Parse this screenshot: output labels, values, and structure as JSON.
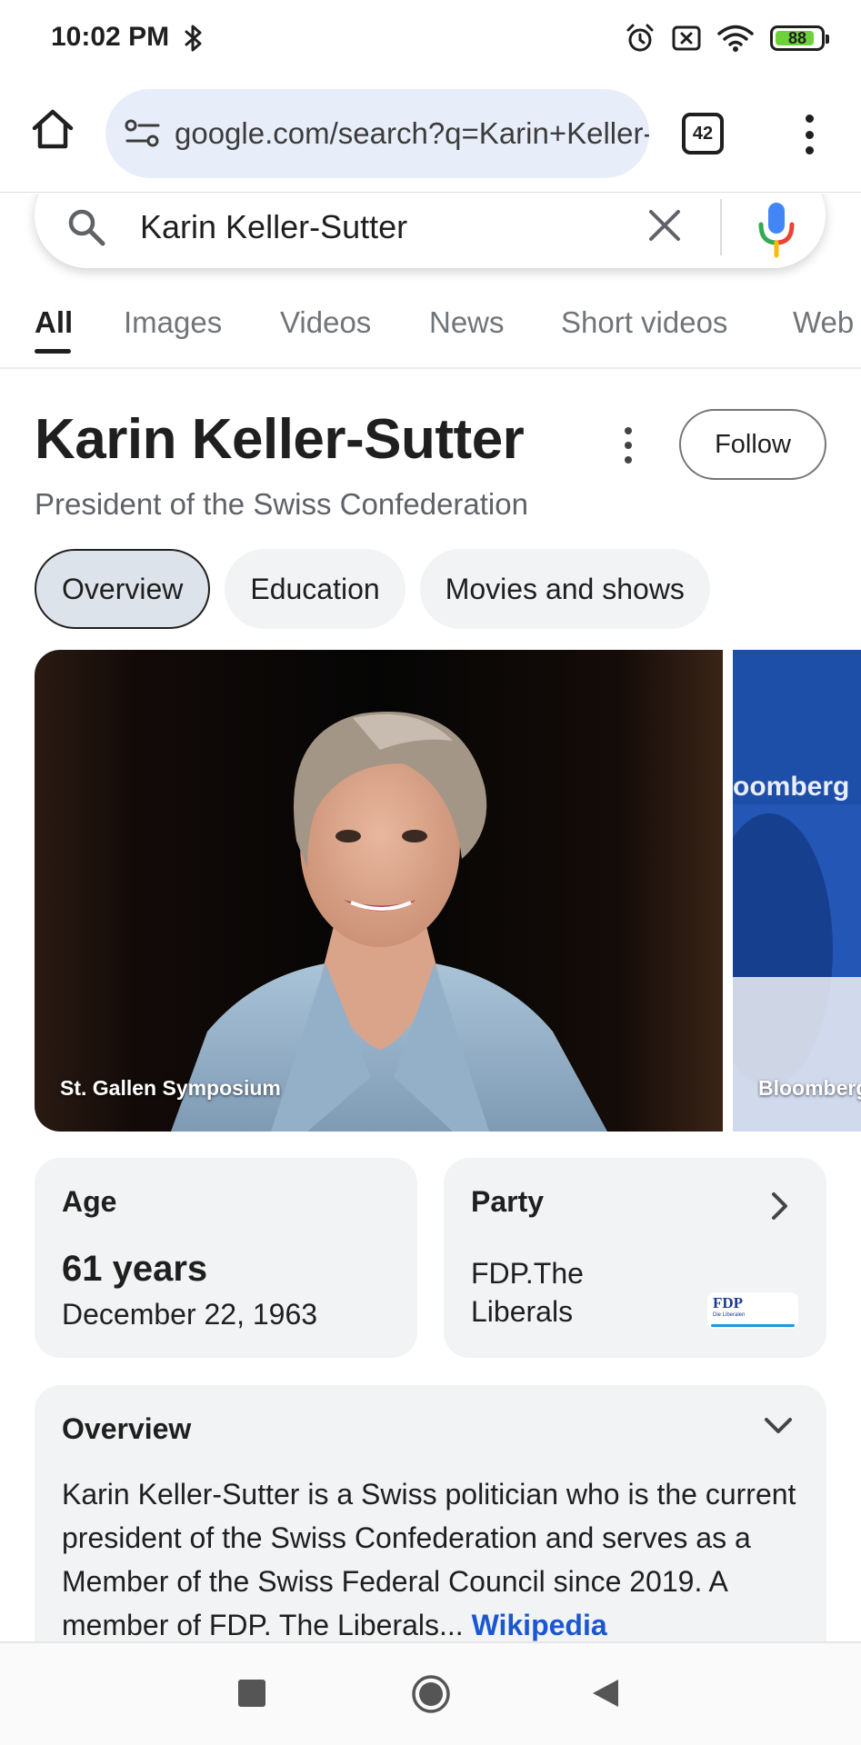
{
  "status_bar": {
    "time": "10:02 PM",
    "battery": "88",
    "icons": [
      "bluetooth-icon",
      "alarm-icon",
      "no-sim-icon",
      "wifi-icon",
      "battery-icon"
    ]
  },
  "browser": {
    "url": "google.com/search?q=Karin+Keller-Sutter",
    "tab_count": "42",
    "icons": [
      "home-icon",
      "site-settings-icon",
      "tabs-icon",
      "more-vert-icon"
    ]
  },
  "search": {
    "query": "Karin Keller-Sutter",
    "icons": [
      "search-icon",
      "clear-icon",
      "mic-icon"
    ]
  },
  "search_tabs": [
    {
      "label": "All",
      "active": true
    },
    {
      "label": "Images",
      "active": false
    },
    {
      "label": "Videos",
      "active": false
    },
    {
      "label": "News",
      "active": false
    },
    {
      "label": "Short videos",
      "active": false
    },
    {
      "label": "Web",
      "active": false
    }
  ],
  "knowledge_panel": {
    "title": "Karin Keller-Sutter",
    "subtitle": "President of the Swiss Confederation",
    "follow_label": "Follow",
    "chips": [
      {
        "label": "Overview",
        "selected": true
      },
      {
        "label": "Education",
        "selected": false
      },
      {
        "label": "Movies and shows",
        "selected": false
      }
    ],
    "images": [
      {
        "caption": "St. Gallen Symposium"
      },
      {
        "caption": "Bloomberg"
      }
    ],
    "age": {
      "label": "Age",
      "value": "61 years",
      "date": "December 22, 1963"
    },
    "party": {
      "label": "Party",
      "value": "FDP.The Liberals",
      "logo_text": "FDP",
      "logo_subtext": "Die Liberalen"
    },
    "overview": {
      "title": "Overview",
      "text": "Karin Keller-Sutter is a Swiss politician who is the current president of the Swiss Confederation and serves as a Member of the Swiss Federal Council since 2019. A member of FDP. The Liberals",
      "ellipsis": "...",
      "source": "Wikipedia"
    }
  },
  "nav_bar": {
    "icons": [
      "recents-icon",
      "home-circle-icon",
      "back-icon"
    ]
  },
  "colors": {
    "url_bar_bg": "#e8eef9",
    "card_bg": "#f1f3f4",
    "chip_selected_bg": "#dde3ea",
    "link_blue": "#1a57d0",
    "battery_green": "#6fd13a"
  }
}
